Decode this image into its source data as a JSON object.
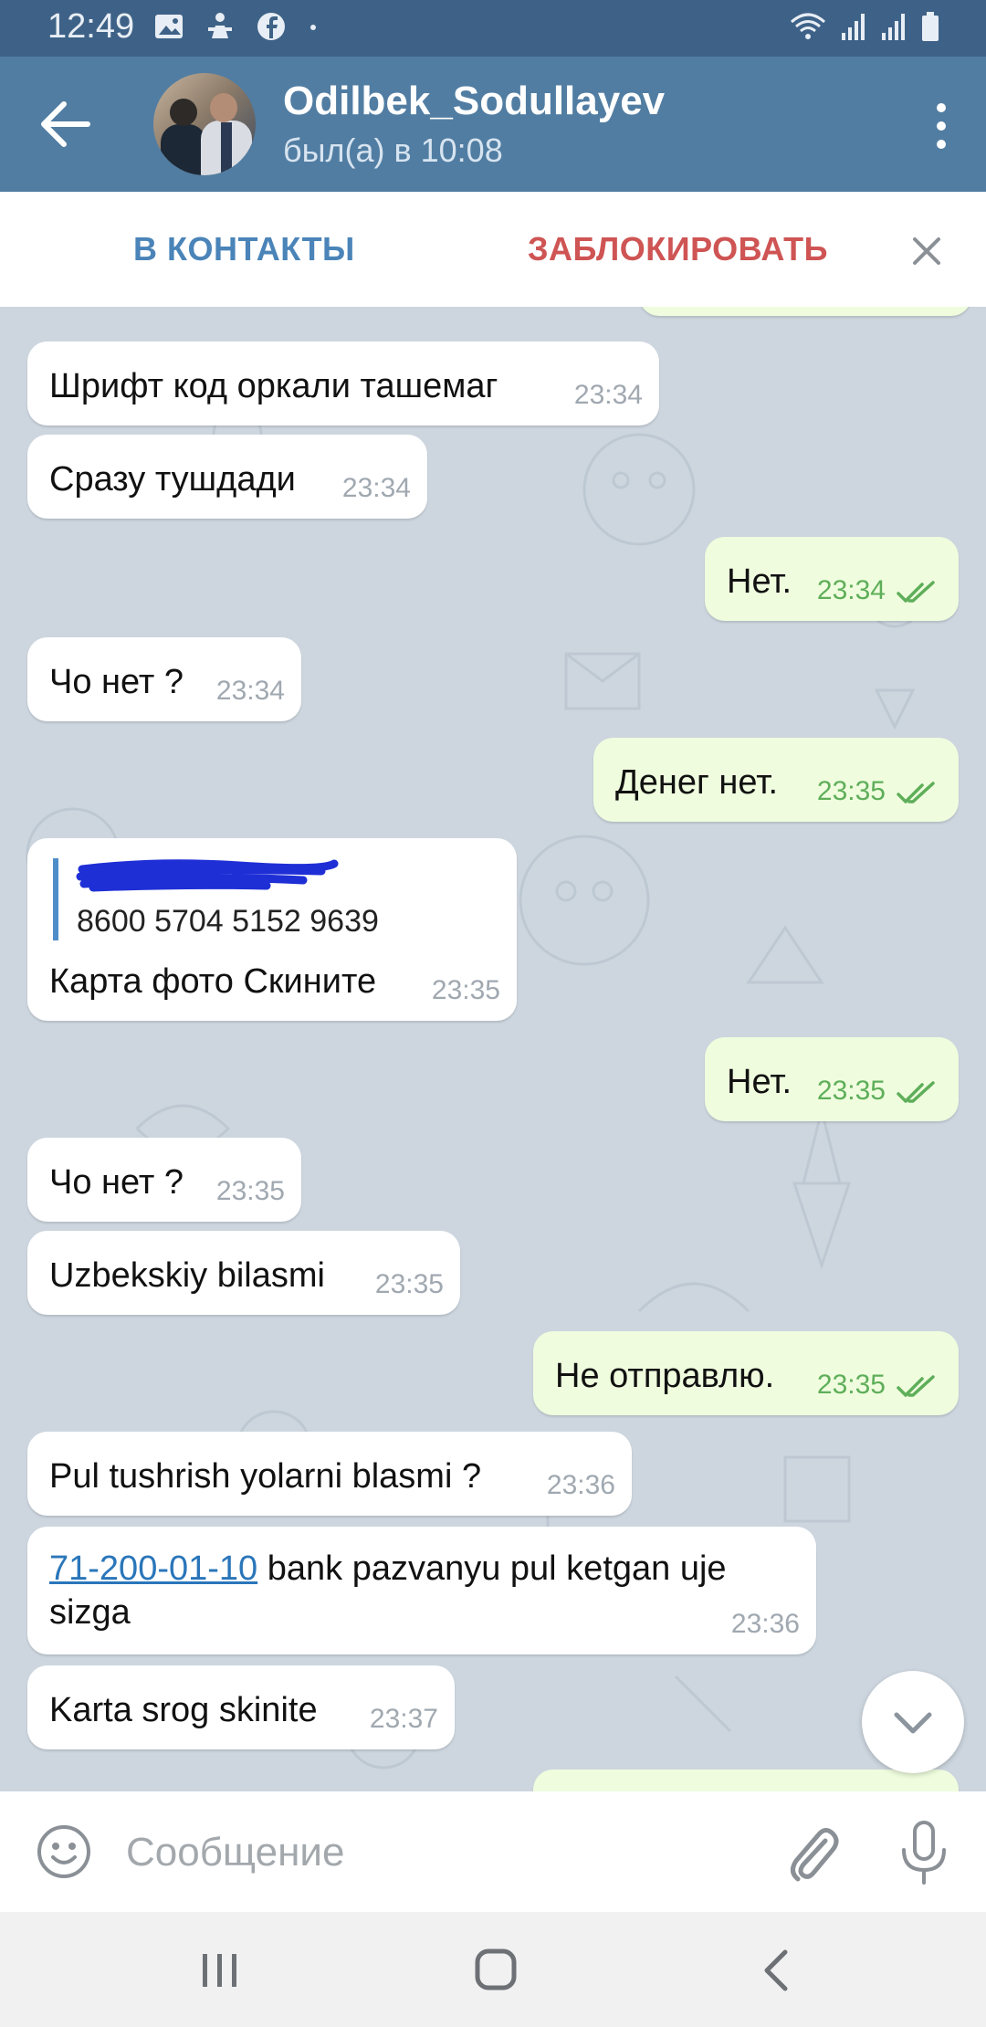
{
  "status_bar": {
    "time": "12:49",
    "left_icons": [
      "gallery-icon",
      "notification-icon",
      "facebook-icon",
      "dot-icon"
    ],
    "right_icons": [
      "wifi-icon",
      "signal-icon",
      "signal-icon",
      "battery-icon"
    ]
  },
  "header": {
    "contact_name": "Odilbek_Sodullayev",
    "last_seen": "был(а) в 10:08"
  },
  "action_bar": {
    "add_contact": "В КОНТАКТЫ",
    "block": "ЗАБЛОКИРОВАТЬ"
  },
  "messages": [
    {
      "dir": "in",
      "text": "Шрифт код оркали ташемаг",
      "time": "23:34"
    },
    {
      "dir": "in",
      "text": "Сразу тушдади",
      "time": "23:34"
    },
    {
      "dir": "out",
      "text": "Нет.",
      "time": "23:34",
      "read": true
    },
    {
      "dir": "in",
      "text": "Чо нет ?",
      "time": "23:34"
    },
    {
      "dir": "out",
      "text": "Денег нет.",
      "time": "23:35",
      "read": true
    },
    {
      "dir": "in",
      "reply": "8600 5704 5152 9639",
      "text": "Карта фото Скините",
      "time": "23:35"
    },
    {
      "dir": "out",
      "text": "Нет.",
      "time": "23:35",
      "read": true
    },
    {
      "dir": "in",
      "text": "Чо нет ?",
      "time": "23:35"
    },
    {
      "dir": "in",
      "text": "Uzbekskiy bilasmi",
      "time": "23:35"
    },
    {
      "dir": "out",
      "text": "Не отправлю.",
      "time": "23:35",
      "read": true
    },
    {
      "dir": "in",
      "text": "Pul tushrish yolarni blasmi ?",
      "time": "23:36"
    },
    {
      "dir": "in",
      "link": "71-200-01-10",
      "text": " bank pazvanyu pul ketgan uje",
      "text2": "sizga",
      "time": "23:36"
    },
    {
      "dir": "in",
      "text": "Karta srog skinite",
      "time": "23:37"
    }
  ],
  "input": {
    "placeholder": "Сообщение"
  },
  "colors": {
    "header": "#517da2",
    "status_bar": "#3e6287",
    "chat_background": "#cdd6df",
    "incoming_bubble": "#ffffff",
    "outgoing_bubble": "#effdde",
    "read_check": "#5fae5a",
    "link": "#2a76ba",
    "block_text": "#cf5454",
    "add_contact_text": "#4a84b8"
  }
}
